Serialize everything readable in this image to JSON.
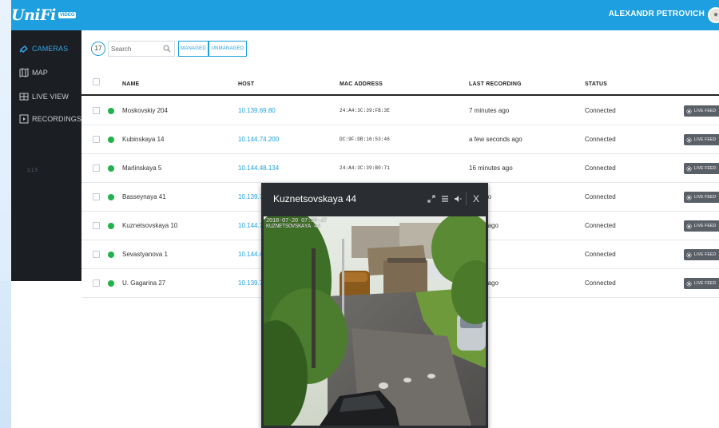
{
  "app": {
    "logo": "UniFi",
    "logo_badge": "VIDEO",
    "user_name": "ALEXANDR PETROVICH",
    "accent": "#1d9fe0"
  },
  "sidebar": {
    "items": [
      {
        "label": "CAMERAS",
        "icon": "camera-icon",
        "active": true
      },
      {
        "label": "MAP",
        "icon": "map-icon",
        "active": false
      },
      {
        "label": "LIVE VIEW",
        "icon": "live-view-icon",
        "active": false
      },
      {
        "label": "RECORDINGS",
        "icon": "play-icon",
        "active": false
      }
    ],
    "version": "3.1.5"
  },
  "toolbar": {
    "camera_count": "17",
    "search_placeholder": "Search",
    "filter_managed": "MANAGED",
    "filter_unmanaged": "UNMANAGED"
  },
  "table": {
    "columns": [
      "NAME",
      "HOST",
      "MAC ADDRESS",
      "LAST RECORDING",
      "STATUS"
    ],
    "live_feed_label": "LIVE FEED",
    "status_color": "#21b24b",
    "rows": [
      {
        "name": "Moskovskiy 204",
        "host": "10.139.69.80",
        "mac": "24:A4:3C:39:FB:3E",
        "last_recording": "7 minutes ago",
        "status": "Connected"
      },
      {
        "name": "Kubinskaya 14",
        "host": "10.144.74.200",
        "mac": "DC:9F:DB:16:53:46",
        "last_recording": "a few seconds ago",
        "status": "Connected"
      },
      {
        "name": "Marlinskaya 5",
        "host": "10.144.48.134",
        "mac": "24:A4:3C:39:B0:71",
        "last_recording": "16 minutes ago",
        "status": "Connected"
      },
      {
        "name": "Basseynaya 41",
        "host": "10.139.77",
        "mac": "",
        "last_recording": "ites ago",
        "status": "Connected"
      },
      {
        "name": "Kuznetsovskaya 10",
        "host": "10.144.71",
        "mac": "",
        "last_recording": "conds ago",
        "status": "Connected"
      },
      {
        "name": "Sevastyanova 1",
        "host": "10.144.45",
        "mac": "",
        "last_recording": "es ago",
        "status": "Connected"
      },
      {
        "name": "U. Gagarina 27",
        "host": "10.139.71",
        "mac": "",
        "last_recording": "conds ago",
        "status": "Connected"
      }
    ]
  },
  "popup": {
    "title": "Kuznetsovskaya 44",
    "stamp_line1": "2018-07-20 07:36:47",
    "stamp_line2": "KUZNETSOVSKAYA 44",
    "controls": [
      "expand-icon",
      "menu-icon",
      "audio-icon",
      "close-icon"
    ],
    "close_label": "X"
  }
}
